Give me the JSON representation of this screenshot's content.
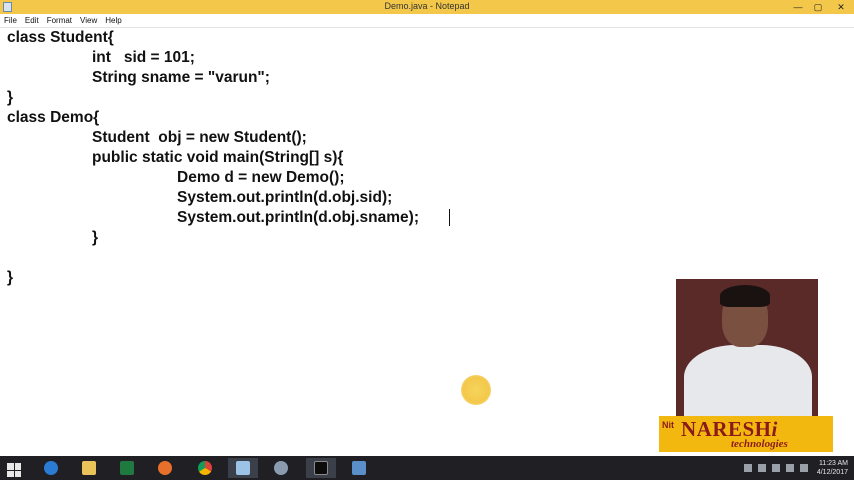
{
  "window": {
    "title": "Demo.java - Notepad",
    "controls": {
      "minimize": "—",
      "maximize": "▢",
      "close": "✕"
    }
  },
  "menu": [
    "File",
    "Edit",
    "Format",
    "View",
    "Help"
  ],
  "code_lines": [
    "class Student{",
    "\t\tint   sid = 101;",
    "\t\tString sname = \"varun\";",
    "}",
    "class Demo{",
    "\t\tStudent  obj = new Student();",
    "\t\tpublic static void main(String[] s){",
    "\t\t\t\tDemo d = new Demo();",
    "\t\t\t\tSystem.out.println(d.obj.sid);",
    "\t\t\t\tSystem.out.println(d.obj.sname);",
    "\t\t}",
    "",
    "}"
  ],
  "logo": {
    "mark": "Nit",
    "name": "NARESH",
    "accent": "i",
    "tagline": "technologies"
  },
  "taskbar": {
    "apps": [
      "start",
      "internet-explorer",
      "file-explorer",
      "excel",
      "firefox",
      "chrome",
      "notepad",
      "settings",
      "command-prompt",
      "network-tool"
    ],
    "clock_time": "11:23 AM",
    "clock_date": "4/12/2017"
  },
  "colors": {
    "titlebar": "#f3c84a",
    "taskbar": "#1f1f24",
    "logo_bg": "#f3b810",
    "logo_text": "#8b1a1a"
  }
}
